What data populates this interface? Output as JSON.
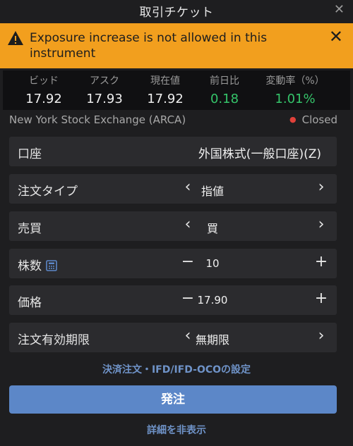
{
  "window": {
    "title": "取引チケット",
    "close_icon": "close-icon"
  },
  "alert": {
    "message": "Exposure increase is not allowed in this instrument",
    "icon": "warning-icon",
    "color": "#f29f1e"
  },
  "quotes": [
    {
      "label": "ビッド",
      "value": "17.92"
    },
    {
      "label": "アスク",
      "value": "17.93"
    },
    {
      "label": "現在値",
      "value": "17.92"
    },
    {
      "label": "前日比",
      "value": "0.18"
    },
    {
      "label": "変動率（%）",
      "value": "1.01%"
    }
  ],
  "market": {
    "exchange": "New York Stock Exchange (ARCA)",
    "status": "Closed",
    "status_color": "#e0413a"
  },
  "form": {
    "account": {
      "label": "口座",
      "value": "外国株式(一般口座)(Z)"
    },
    "order_type": {
      "label": "注文タイプ",
      "value": "指値"
    },
    "side": {
      "label": "売買",
      "value": "買"
    },
    "quantity": {
      "label": "株数",
      "value": "10"
    },
    "price": {
      "label": "価格",
      "value": "17.90"
    },
    "validity": {
      "label": "注文有効期限",
      "value": "無期限"
    }
  },
  "links": {
    "settlement": "決済注文・IFD/IFD-OCOの設定",
    "hide_details": "詳細を非表示"
  },
  "submit_label": "発注",
  "accent_color": "#5c87c8",
  "positive_color": "#35c46a"
}
